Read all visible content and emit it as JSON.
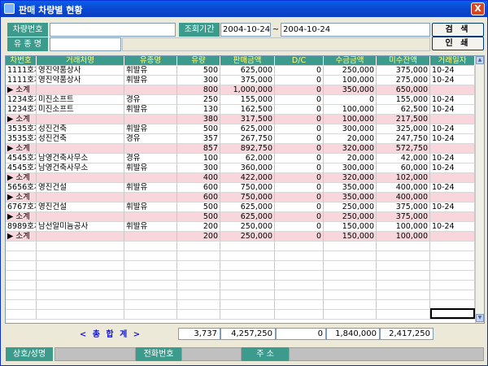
{
  "window": {
    "title": "판매 차량별 현황",
    "close_label": "X"
  },
  "filters": {
    "vehicle_no_label": "차량번호",
    "vehicle_no_value": "",
    "period_label": "조회기간",
    "date_from": "2004-10-24",
    "date_sep": "~",
    "date_to": "2004-10-24",
    "fuel_label": "유 종 명",
    "fuel_value": ""
  },
  "buttons": {
    "search": "검 색",
    "print": "인 쇄"
  },
  "grid": {
    "columns": [
      "차번호",
      "거래처명",
      "유종명",
      "유량",
      "판매금액",
      "D/C",
      "수금금액",
      "미수잔액",
      "거래일자"
    ],
    "rows": [
      {
        "type": "data",
        "c": [
          "1111호차",
          "영진약품상사",
          "휘발유",
          "500",
          "625,000",
          "0",
          "250,000",
          "375,000",
          "10-24"
        ]
      },
      {
        "type": "data",
        "c": [
          "1111호차",
          "영진약품상사",
          "휘발유",
          "300",
          "375,000",
          "0",
          "100,000",
          "275,000",
          "10-24"
        ]
      },
      {
        "type": "sub",
        "c": [
          "▶ 소계",
          "",
          "",
          "800",
          "1,000,000",
          "0",
          "350,000",
          "650,000",
          ""
        ]
      },
      {
        "type": "data",
        "c": [
          "1234호차",
          "미진소프트",
          "경유",
          "250",
          "155,000",
          "0",
          "0",
          "155,000",
          "10-24"
        ]
      },
      {
        "type": "data",
        "c": [
          "1234호차",
          "미진소프트",
          "휘발유",
          "130",
          "162,500",
          "0",
          "100,000",
          "62,500",
          "10-24"
        ]
      },
      {
        "type": "sub",
        "c": [
          "▶ 소계",
          "",
          "",
          "380",
          "317,500",
          "0",
          "100,000",
          "217,500",
          ""
        ]
      },
      {
        "type": "data",
        "c": [
          "3535호차",
          "성진건축",
          "휘발유",
          "500",
          "625,000",
          "0",
          "300,000",
          "325,000",
          "10-24"
        ]
      },
      {
        "type": "data",
        "c": [
          "3535호차",
          "성진건축",
          "경유",
          "357",
          "267,750",
          "0",
          "20,000",
          "247,750",
          "10-24"
        ]
      },
      {
        "type": "sub",
        "c": [
          "▶ 소계",
          "",
          "",
          "857",
          "892,750",
          "0",
          "320,000",
          "572,750",
          ""
        ]
      },
      {
        "type": "data",
        "c": [
          "4545호차",
          "남영건축사무소",
          "경유",
          "100",
          "62,000",
          "0",
          "20,000",
          "42,000",
          "10-24"
        ]
      },
      {
        "type": "data",
        "c": [
          "4545호차",
          "남영건축사무소",
          "휘발유",
          "300",
          "360,000",
          "0",
          "300,000",
          "60,000",
          "10-24"
        ]
      },
      {
        "type": "sub",
        "c": [
          "▶ 소계",
          "",
          "",
          "400",
          "422,000",
          "0",
          "320,000",
          "102,000",
          ""
        ]
      },
      {
        "type": "data",
        "c": [
          "5656호차",
          "영진건설",
          "휘발유",
          "600",
          "750,000",
          "0",
          "350,000",
          "400,000",
          "10-24"
        ]
      },
      {
        "type": "sub",
        "c": [
          "▶ 소계",
          "",
          "",
          "600",
          "750,000",
          "0",
          "350,000",
          "400,000",
          ""
        ]
      },
      {
        "type": "data",
        "c": [
          "6767호차",
          "영진건설",
          "휘발유",
          "500",
          "625,000",
          "0",
          "250,000",
          "375,000",
          "10-24"
        ]
      },
      {
        "type": "sub",
        "c": [
          "▶ 소계",
          "",
          "",
          "500",
          "625,000",
          "0",
          "250,000",
          "375,000",
          ""
        ]
      },
      {
        "type": "data",
        "c": [
          "8989호차",
          "남선알미늄공사",
          "휘발유",
          "200",
          "250,000",
          "0",
          "150,000",
          "100,000",
          "10-24"
        ]
      },
      {
        "type": "sub",
        "c": [
          "▶ 소계",
          "",
          "",
          "200",
          "250,000",
          "0",
          "150,000",
          "100,000",
          ""
        ]
      }
    ]
  },
  "totals": {
    "label": "< 총 합 계 >",
    "quantity": "3,737",
    "sales": "4,257,250",
    "dc": "0",
    "collected": "1,840,000",
    "outstanding": "2,417,250"
  },
  "footer": {
    "company_label": "상호/성명",
    "phone_label": "전화번호",
    "address_label": "주 소"
  },
  "colors": {
    "header_bg": "#3c9b8c",
    "header_text": "#ffff80",
    "subtotal_bg": "#f8d6dc",
    "titlebar": "#0a48d2"
  }
}
